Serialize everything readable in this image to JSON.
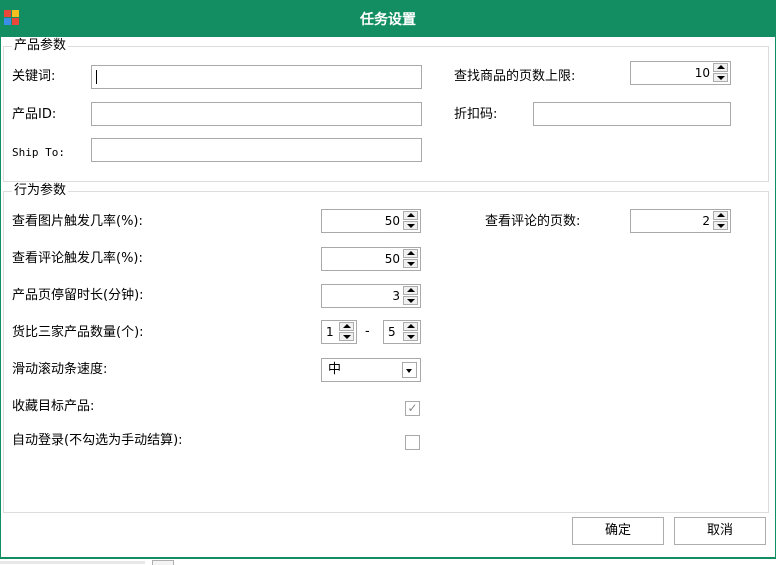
{
  "window": {
    "title": "任务设置"
  },
  "product_group": {
    "title": "产品参数",
    "keyword_label": "关键词:",
    "keyword_value": "",
    "pid_label": "产品ID:",
    "pid_value": "",
    "ship_label": "Ship To:",
    "ship_value": "",
    "max_pages_label": "查找商品的页数上限:",
    "max_pages_value": "10",
    "discount_label": "折扣码:",
    "discount_value": ""
  },
  "behavior_group": {
    "title": "行为参数",
    "view_image_label": "查看图片触发几率(%):",
    "view_image_value": "50",
    "review_pages_label": "查看评论的页数:",
    "review_pages_value": "2",
    "view_review_label": "查看评论触发几率(%):",
    "view_review_value": "50",
    "stay_label": "产品页停留时长(分钟):",
    "stay_value": "3",
    "compare_label": "货比三家产品数量(个):",
    "compare_min": "1",
    "compare_sep": "-",
    "compare_max": "5",
    "scroll_label": "滑动滚动条速度:",
    "scroll_value": "中",
    "favorite_label": "收藏目标产品:",
    "favorite_checked": true,
    "autologin_label": "自动登录(不勾选为手动结算):",
    "autologin_checked": false
  },
  "buttons": {
    "ok": "确定",
    "cancel": "取消"
  },
  "colors": {
    "titlebar": "#138e63",
    "border": "#dcdcdc"
  }
}
